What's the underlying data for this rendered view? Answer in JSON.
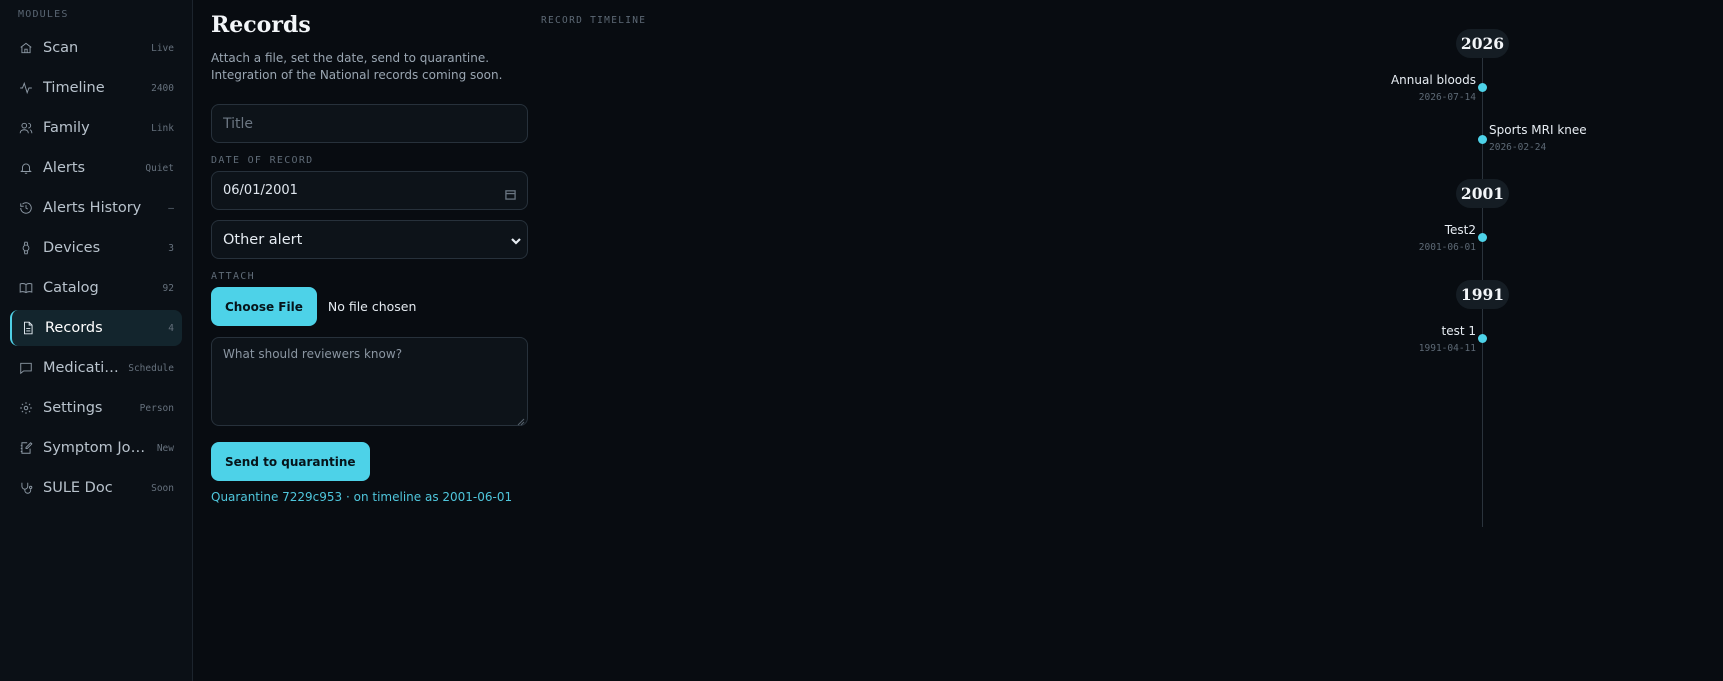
{
  "sidebar": {
    "section_label": "MODULES",
    "items": [
      {
        "label": "Scan",
        "badge": "Live",
        "icon": "home-icon"
      },
      {
        "label": "Timeline",
        "badge": "2400",
        "icon": "activity-icon"
      },
      {
        "label": "Family",
        "badge": "Link",
        "icon": "users-icon"
      },
      {
        "label": "Alerts",
        "badge": "Quiet",
        "icon": "bell-icon"
      },
      {
        "label": "Alerts History",
        "badge": "–",
        "icon": "history-icon"
      },
      {
        "label": "Devices",
        "badge": "3",
        "icon": "watch-icon"
      },
      {
        "label": "Catalog",
        "badge": "92",
        "icon": "book-icon"
      },
      {
        "label": "Records",
        "badge": "4",
        "icon": "file-text-icon",
        "active": true
      },
      {
        "label": "Medication",
        "badge": "Schedule",
        "icon": "message-square-icon"
      },
      {
        "label": "Settings",
        "badge": "Person",
        "icon": "gear-icon"
      },
      {
        "label": "Symptom Jou...",
        "badge": "New",
        "icon": "notebook-pen-icon"
      },
      {
        "label": "SULE Doc",
        "badge": "Soon",
        "icon": "stethoscope-icon"
      }
    ]
  },
  "records": {
    "title": "Records",
    "subtitle_line1": "Attach a file, set the date, send to quarantine.",
    "subtitle_line2": "Integration of the National records coming soon.",
    "title_placeholder": "Title",
    "date_label": "DATE OF RECORD",
    "date_value": "06/01/2001",
    "type_value": "Other alert",
    "attach_label": "ATTACH",
    "choose_file_label": "Choose File",
    "no_file_text": "No file chosen",
    "notes_placeholder": "What should reviewers know?",
    "send_label": "Send to quarantine",
    "status_text": "Quarantine 7229c953 · on timeline as 2001-06-01"
  },
  "timeline": {
    "label": "RECORD TIMELINE",
    "years": [
      {
        "year": "2026",
        "entries": [
          {
            "title": "Annual bloods",
            "date": "2026-07-14",
            "side": "left"
          },
          {
            "title": "Sports MRI knee",
            "date": "2026-02-24",
            "side": "right"
          }
        ]
      },
      {
        "year": "2001",
        "entries": [
          {
            "title": "Test2",
            "date": "2001-06-01",
            "side": "left"
          }
        ]
      },
      {
        "year": "1991",
        "entries": [
          {
            "title": "test 1",
            "date": "1991-04-11",
            "side": "left"
          }
        ]
      }
    ]
  },
  "colors": {
    "accent": "#4dd2e8",
    "background": "#080c11",
    "sidebar": "#0b1016",
    "active_item": "#13252d"
  }
}
